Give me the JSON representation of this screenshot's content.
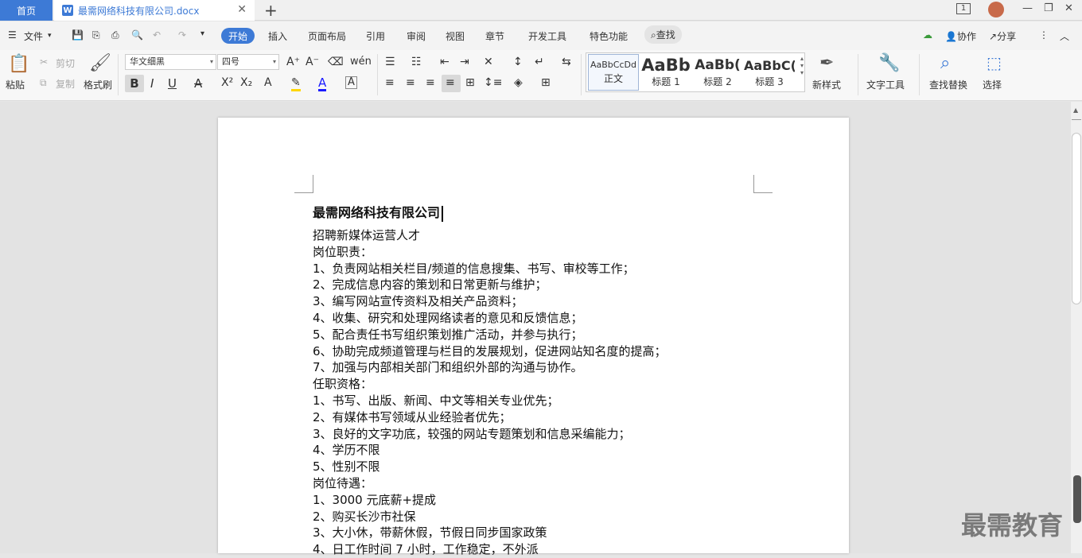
{
  "tabs": {
    "home": "首页",
    "document": "最需网络科技有限公司.docx",
    "doc_icon": "W"
  },
  "menu": {
    "file": "文件",
    "items": [
      "开始",
      "插入",
      "页面布局",
      "引用",
      "审阅",
      "视图",
      "章节",
      "开发工具",
      "特色功能"
    ],
    "search": "查找",
    "collab": "协作",
    "share": "分享"
  },
  "window": {
    "tab_count": "1"
  },
  "ribbon": {
    "paste": "粘贴",
    "cut": "剪切",
    "copy": "复制",
    "format_painter": "格式刷",
    "font_name": "华文细黑",
    "font_size": "四号",
    "styles": [
      {
        "preview": "AaBbCcDd",
        "label": "正文"
      },
      {
        "preview": "AaBb",
        "label": "标题 1"
      },
      {
        "preview": "AaBb(",
        "label": "标题 2"
      },
      {
        "preview": "AaBbC(",
        "label": "标题 3"
      }
    ],
    "new_style": "新样式",
    "text_tools": "文字工具",
    "find_replace": "查找替换",
    "select": "选择"
  },
  "document": {
    "title": "最需网络科技有限公司",
    "lines": [
      "招聘新媒体运营人才",
      "岗位职责：",
      "1、负责网站相关栏目/频道的信息搜集、书写、审校等工作；",
      "2、完成信息内容的策划和日常更新与维护；",
      "3、编写网站宣传资料及相关产品资料；",
      "4、收集、研究和处理网络读者的意见和反馈信息；",
      "5、配合责任书写组织策划推广活动，并参与执行；",
      "6、协助完成频道管理与栏目的发展规划，促进网站知名度的提高；",
      "7、加强与内部相关部门和组织外部的沟通与协作。",
      "任职资格：",
      "1、书写、出版、新闻、中文等相关专业优先；",
      "2、有媒体书写领域从业经验者优先；",
      "3、良好的文字功底，较强的网站专题策划和信息采编能力；",
      "4、学历不限",
      "5、性别不限",
      "岗位待遇：",
      "1、3000 元底薪+提成",
      "2、购买长沙市社保",
      "3、大小休，带薪休假，节假日同步国家政策",
      "4、日工作时间 7 小时，工作稳定，不外派"
    ]
  },
  "watermark": "最需教育"
}
